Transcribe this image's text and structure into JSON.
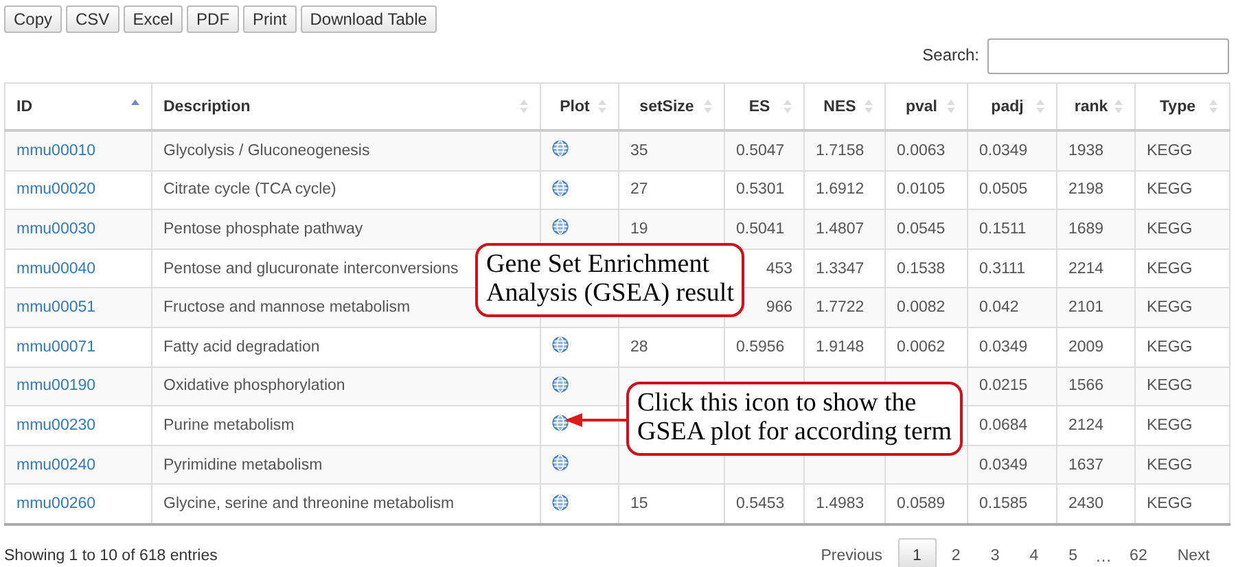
{
  "toolbar": {
    "buttons": [
      "Copy",
      "CSV",
      "Excel",
      "PDF",
      "Print",
      "Download Table"
    ]
  },
  "search": {
    "label": "Search:"
  },
  "table": {
    "columns": [
      {
        "label": "ID",
        "sorted": true
      },
      {
        "label": "Description",
        "sorted": false
      },
      {
        "label": "Plot",
        "sorted": false
      },
      {
        "label": "setSize",
        "sorted": false
      },
      {
        "label": "ES",
        "sorted": false
      },
      {
        "label": "NES",
        "sorted": false
      },
      {
        "label": "pval",
        "sorted": false
      },
      {
        "label": "padj",
        "sorted": false
      },
      {
        "label": "rank",
        "sorted": false
      },
      {
        "label": "Type",
        "sorted": false
      }
    ],
    "rows": [
      {
        "id": "mmu00010",
        "description": "Glycolysis / Gluconeogenesis",
        "plot": true,
        "setSize": "35",
        "es": "0.5047",
        "nes": "1.7158",
        "pval": "0.0063",
        "padj": "0.0349",
        "rank": "1938",
        "type": "KEGG"
      },
      {
        "id": "mmu00020",
        "description": "Citrate cycle (TCA cycle)",
        "plot": true,
        "setSize": "27",
        "es": "0.5301",
        "nes": "1.6912",
        "pval": "0.0105",
        "padj": "0.0505",
        "rank": "2198",
        "type": "KEGG"
      },
      {
        "id": "mmu00030",
        "description": "Pentose phosphate pathway",
        "plot": true,
        "setSize": "19",
        "es": "0.5041",
        "nes": "1.4807",
        "pval": "0.0545",
        "padj": "0.1511",
        "rank": "1689",
        "type": "KEGG"
      },
      {
        "id": "mmu00040",
        "description": "Pentose and glucuronate interconversions",
        "setSize": null,
        "es": "453",
        "nes": "1.3347",
        "pval": "0.1538",
        "padj": "0.3111",
        "rank": "2214",
        "type": "KEGG"
      },
      {
        "id": "mmu00051",
        "description": "Fructose and mannose metabolism",
        "setSize": null,
        "es": "966",
        "nes": "1.7722",
        "pval": "0.0082",
        "padj": "0.042",
        "rank": "2101",
        "type": "KEGG"
      },
      {
        "id": "mmu00071",
        "description": "Fatty acid degradation",
        "plot": true,
        "setSize": "28",
        "es": "0.5956",
        "nes": "1.9148",
        "pval": "0.0062",
        "padj": "0.0349",
        "rank": "2009",
        "type": "KEGG"
      },
      {
        "id": "mmu00190",
        "description": "Oxidative phosphorylation",
        "plot": true,
        "setSize": null,
        "es": null,
        "nes": null,
        "pval": null,
        "padj": "0.0215",
        "rank": "1566",
        "type": "KEGG"
      },
      {
        "id": "mmu00230",
        "description": "Purine metabolism",
        "plot": true,
        "setSize": null,
        "es": null,
        "nes": null,
        "pval": null,
        "padj": "0.0684",
        "rank": "2124",
        "type": "KEGG"
      },
      {
        "id": "mmu00240",
        "description": "Pyrimidine metabolism",
        "plot": true,
        "setSize": null,
        "es": null,
        "nes": null,
        "pval": null,
        "padj": "0.0349",
        "rank": "1637",
        "type": "KEGG"
      },
      {
        "id": "mmu00260",
        "description": "Glycine, serine and threonine metabolism",
        "plot": true,
        "setSize": "15",
        "es": "0.5453",
        "nes": "1.4983",
        "pval": "0.0589",
        "padj": "0.1585",
        "rank": "2430",
        "type": "KEGG"
      }
    ]
  },
  "info": "Showing 1 to 10 of 618 entries",
  "pagination": [
    {
      "label": "Previous",
      "kind": "nav",
      "selected": false
    },
    {
      "label": "1",
      "kind": "page",
      "selected": true
    },
    {
      "label": "2",
      "kind": "page",
      "selected": false
    },
    {
      "label": "3",
      "kind": "page",
      "selected": false
    },
    {
      "label": "4",
      "kind": "page",
      "selected": false
    },
    {
      "label": "5",
      "kind": "page",
      "selected": false
    },
    {
      "label": "…",
      "kind": "gap",
      "selected": false
    },
    {
      "label": "62",
      "kind": "page",
      "selected": false
    },
    {
      "label": "Next",
      "kind": "nav",
      "selected": false
    }
  ],
  "callouts": [
    {
      "text": "Gene Set Enrichment\nAnalysis (GSEA) result",
      "kind": "note"
    },
    {
      "text": "Click this icon to show the\nGSEA plot for according term",
      "kind": "pointer"
    }
  ]
}
